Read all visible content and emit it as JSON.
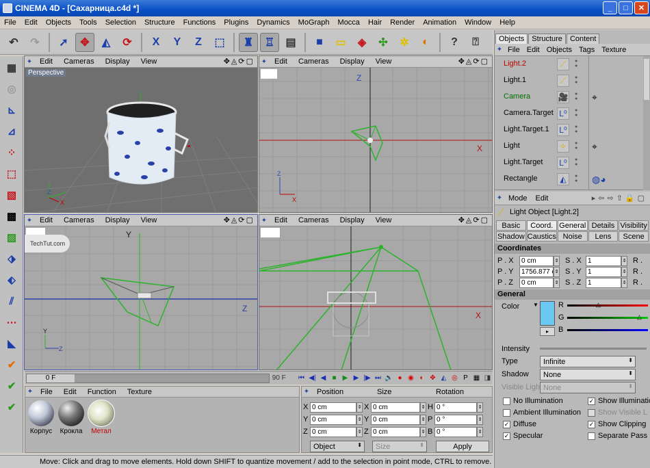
{
  "window": {
    "title": "CINEMA 4D - [Сахарница.c4d *]",
    "min": "_",
    "max": "□",
    "close": "✕"
  },
  "menu": [
    "File",
    "Edit",
    "Objects",
    "Tools",
    "Selection",
    "Structure",
    "Functions",
    "Plugins",
    "Dynamics",
    "MoGraph",
    "Mocca",
    "Hair",
    "Render",
    "Animation",
    "Window",
    "Help"
  ],
  "viewport_menu": [
    "Edit",
    "Cameras",
    "Display",
    "View"
  ],
  "viewports": {
    "perspective_label": "Perspective",
    "watermark": "TechTut.com"
  },
  "axes": {
    "x": "X",
    "y": "Y",
    "z": "Z"
  },
  "timeline": {
    "current_frame": "0 F",
    "end_frame": "90 F"
  },
  "materials": {
    "menu": [
      "File",
      "Edit",
      "Function",
      "Texture"
    ],
    "items": [
      {
        "name": "Корпус",
        "selected": false
      },
      {
        "name": "Крокла",
        "selected": false
      },
      {
        "name": "Метал",
        "selected": true
      }
    ]
  },
  "coordinates": {
    "headers": [
      "Position",
      "Size",
      "Rotation"
    ],
    "rows": [
      {
        "axis": "X",
        "pos": "0 cm",
        "size_axis": "X",
        "size": "0 cm",
        "rot_axis": "H",
        "rot": "0 °"
      },
      {
        "axis": "Y",
        "pos": "0 cm",
        "size_axis": "Y",
        "size": "0 cm",
        "rot_axis": "P",
        "rot": "0 °"
      },
      {
        "axis": "Z",
        "pos": "0 cm",
        "size_axis": "Z",
        "size": "0 cm",
        "rot_axis": "B",
        "rot": "0 °"
      }
    ],
    "mode": "Object",
    "size_mode": "Size",
    "apply": "Apply"
  },
  "status": "Move: Click and drag to move elements. Hold down SHIFT to quantize movement / add to the selection in point mode, CTRL to remove.",
  "objects_panel": {
    "tabs": [
      "Objects",
      "Structure",
      "Content"
    ],
    "menu": [
      "File",
      "Edit",
      "Objects",
      "Tags",
      "Texture"
    ],
    "items": [
      {
        "name": "Light.2",
        "color": "#c00000"
      },
      {
        "name": "Light.1",
        "color": "#000000"
      },
      {
        "name": "Camera",
        "color": "#007000"
      },
      {
        "name": "Camera.Target",
        "color": "#000000"
      },
      {
        "name": "Light.Target.1",
        "color": "#000000"
      },
      {
        "name": "Light",
        "color": "#000000"
      },
      {
        "name": "Light.Target",
        "color": "#000000"
      },
      {
        "name": "Rectangle",
        "color": "#000000"
      }
    ]
  },
  "attributes": {
    "menu": [
      "Mode",
      "Edit"
    ],
    "title": "Light Object [Light.2]",
    "tabs": [
      "Basic",
      "Coord.",
      "General",
      "Details",
      "Visibility",
      "Shadow",
      "Caustics",
      "Noise",
      "Lens",
      "Scene"
    ],
    "coordinates_title": "Coordinates",
    "coords": [
      {
        "label": "P . X",
        "value": "0 cm",
        "s_label": "S . X",
        "s_value": "1",
        "r_label": "R ."
      },
      {
        "label": "P . Y",
        "value": "1756.877 c",
        "s_label": "S . Y",
        "s_value": "1",
        "r_label": "R ."
      },
      {
        "label": "P . Z",
        "value": "0 cm",
        "s_label": "S . Z",
        "s_value": "1",
        "r_label": "R ."
      }
    ],
    "general_title": "General",
    "color_label": "Color",
    "rgb": [
      "R",
      "G",
      "B"
    ],
    "light_color": "#6bc6f2",
    "intensity_label": "Intensity",
    "type_label": "Type",
    "type_value": "Infinite",
    "shadow_label": "Shadow",
    "shadow_value": "None",
    "visible_light_label": "Visible Light",
    "visible_light_value": "None",
    "checks": [
      {
        "label": "No Illumination",
        "checked": false
      },
      {
        "label": "Show Illumination",
        "checked": true
      },
      {
        "label": "Ambient Illumination",
        "checked": false
      },
      {
        "label": "Show Visible L",
        "checked": false,
        "dim": true
      },
      {
        "label": "Diffuse",
        "checked": true
      },
      {
        "label": "Show Clipping",
        "checked": true
      },
      {
        "label": "Specular",
        "checked": true
      },
      {
        "label": "Separate Pass",
        "checked": false
      }
    ]
  }
}
